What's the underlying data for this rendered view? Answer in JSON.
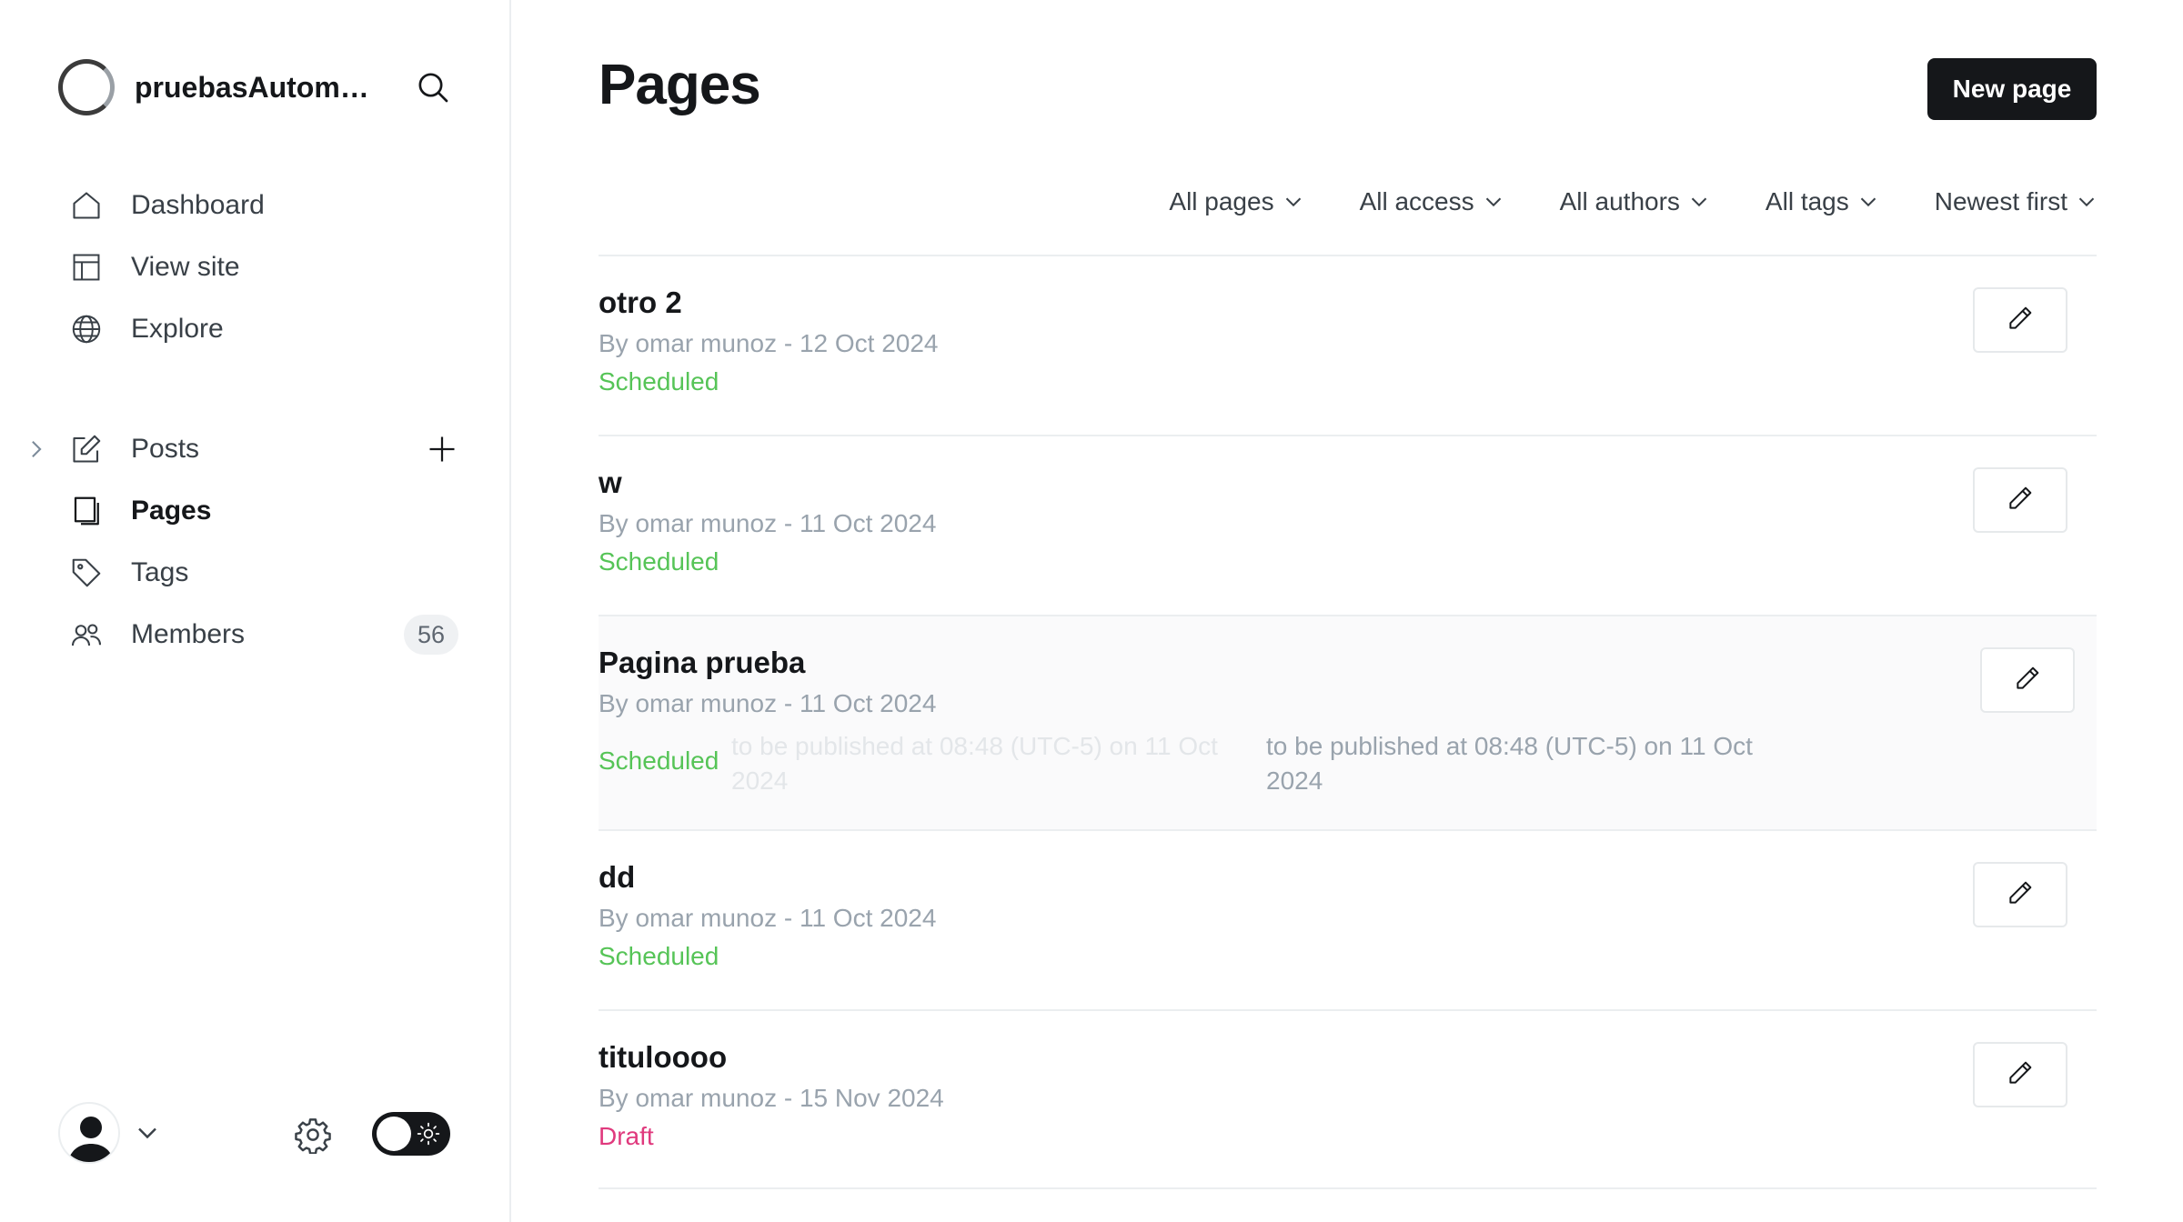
{
  "sidebar": {
    "site_name": "pruebasAutoma...",
    "nav_top": [
      {
        "label": "Dashboard",
        "icon": "home-icon"
      },
      {
        "label": "View site",
        "icon": "layout-icon"
      },
      {
        "label": "Explore",
        "icon": "globe-icon"
      }
    ],
    "nav_mid": [
      {
        "label": "Posts",
        "icon": "edit-icon"
      },
      {
        "label": "Pages",
        "icon": "page-icon"
      },
      {
        "label": "Tags",
        "icon": "tag-icon"
      },
      {
        "label": "Members",
        "icon": "members-icon",
        "count": "56"
      }
    ]
  },
  "main": {
    "title": "Pages",
    "new_button": "New page",
    "filters": [
      "All pages",
      "All access",
      "All authors",
      "All tags",
      "Newest first"
    ],
    "rows": [
      {
        "title": "otro 2",
        "meta": "By omar munoz - 12 Oct 2024",
        "status": "Scheduled"
      },
      {
        "title": "w",
        "meta": "By omar munoz - 11 Oct 2024",
        "status": "Scheduled"
      },
      {
        "title": "Pagina prueba",
        "meta": "By omar munoz - 11 Oct 2024",
        "status": "Scheduled",
        "tooltip": "to be published at 08:48 (UTC-5) on 11 Oct 2024"
      },
      {
        "title": "dd",
        "meta": "By omar munoz - 11 Oct 2024",
        "status": "Scheduled"
      },
      {
        "title": "tituloooo",
        "meta": "By omar munoz - 15 Nov 2024",
        "status": "Draft"
      }
    ]
  },
  "colors": {
    "scheduled": "#56c457",
    "draft": "#e0397d",
    "primary": "#15171a"
  }
}
